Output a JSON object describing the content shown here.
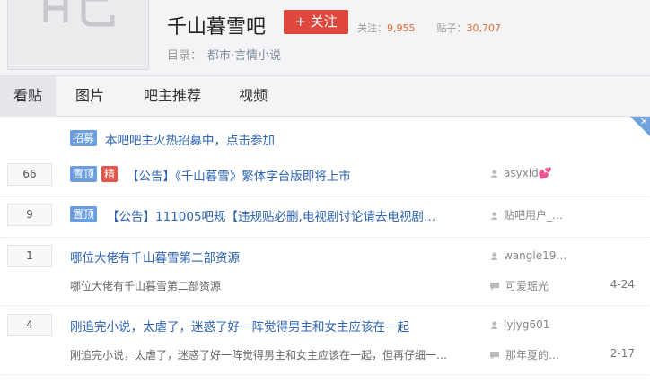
{
  "forum": {
    "title": "千山暮雪吧",
    "follow_label": "+ 关注",
    "followers_label": "关注：",
    "followers_count": "9,955",
    "posts_label": "贴子：",
    "posts_count": "30,707",
    "category_label": "目录：",
    "category_value": "都市·言情小说"
  },
  "tabs": [
    {
      "label": "看贴",
      "active": true
    },
    {
      "label": "图片"
    },
    {
      "label": "吧主推荐"
    },
    {
      "label": "视频"
    }
  ],
  "recruit": {
    "badge": "招募",
    "text": "本吧吧主火热招募中，点击参加"
  },
  "threads": [
    {
      "replies": "66",
      "badges": [
        "置顶",
        "精"
      ],
      "title": "【公告】《千山暮雪》繁体字台版即将上市",
      "author": "asyxld💕"
    },
    {
      "replies": "9",
      "badges": [
        "置顶"
      ],
      "title": "【公告】111005吧规【违规贴必删,电视剧讨论请去电视剧…",
      "author": "贴吧用户_…"
    },
    {
      "replies": "1",
      "title": "哪位大佬有千山暮雪第二部资源",
      "author": "wangle19…",
      "abstract": "哪位大佬有千山暮雪第二部资源",
      "last_reply": "可爱瑶光",
      "date": "4-24"
    },
    {
      "replies": "4",
      "title": "刚追完小说，太虐了，迷惑了好一阵觉得男主和女主应该在一起",
      "author": "lyjyg601",
      "abstract": "刚追完小说，太虐了，迷惑了好一阵觉得男主和女主应该在一起，但再仔细一…",
      "last_reply": "那年夏的…",
      "date": "2-17"
    }
  ],
  "colors": {
    "accent": "#e0473d",
    "link": "#2d64b3",
    "badge_blue": "#6b9ee0",
    "badge_red": "#e4544a"
  }
}
